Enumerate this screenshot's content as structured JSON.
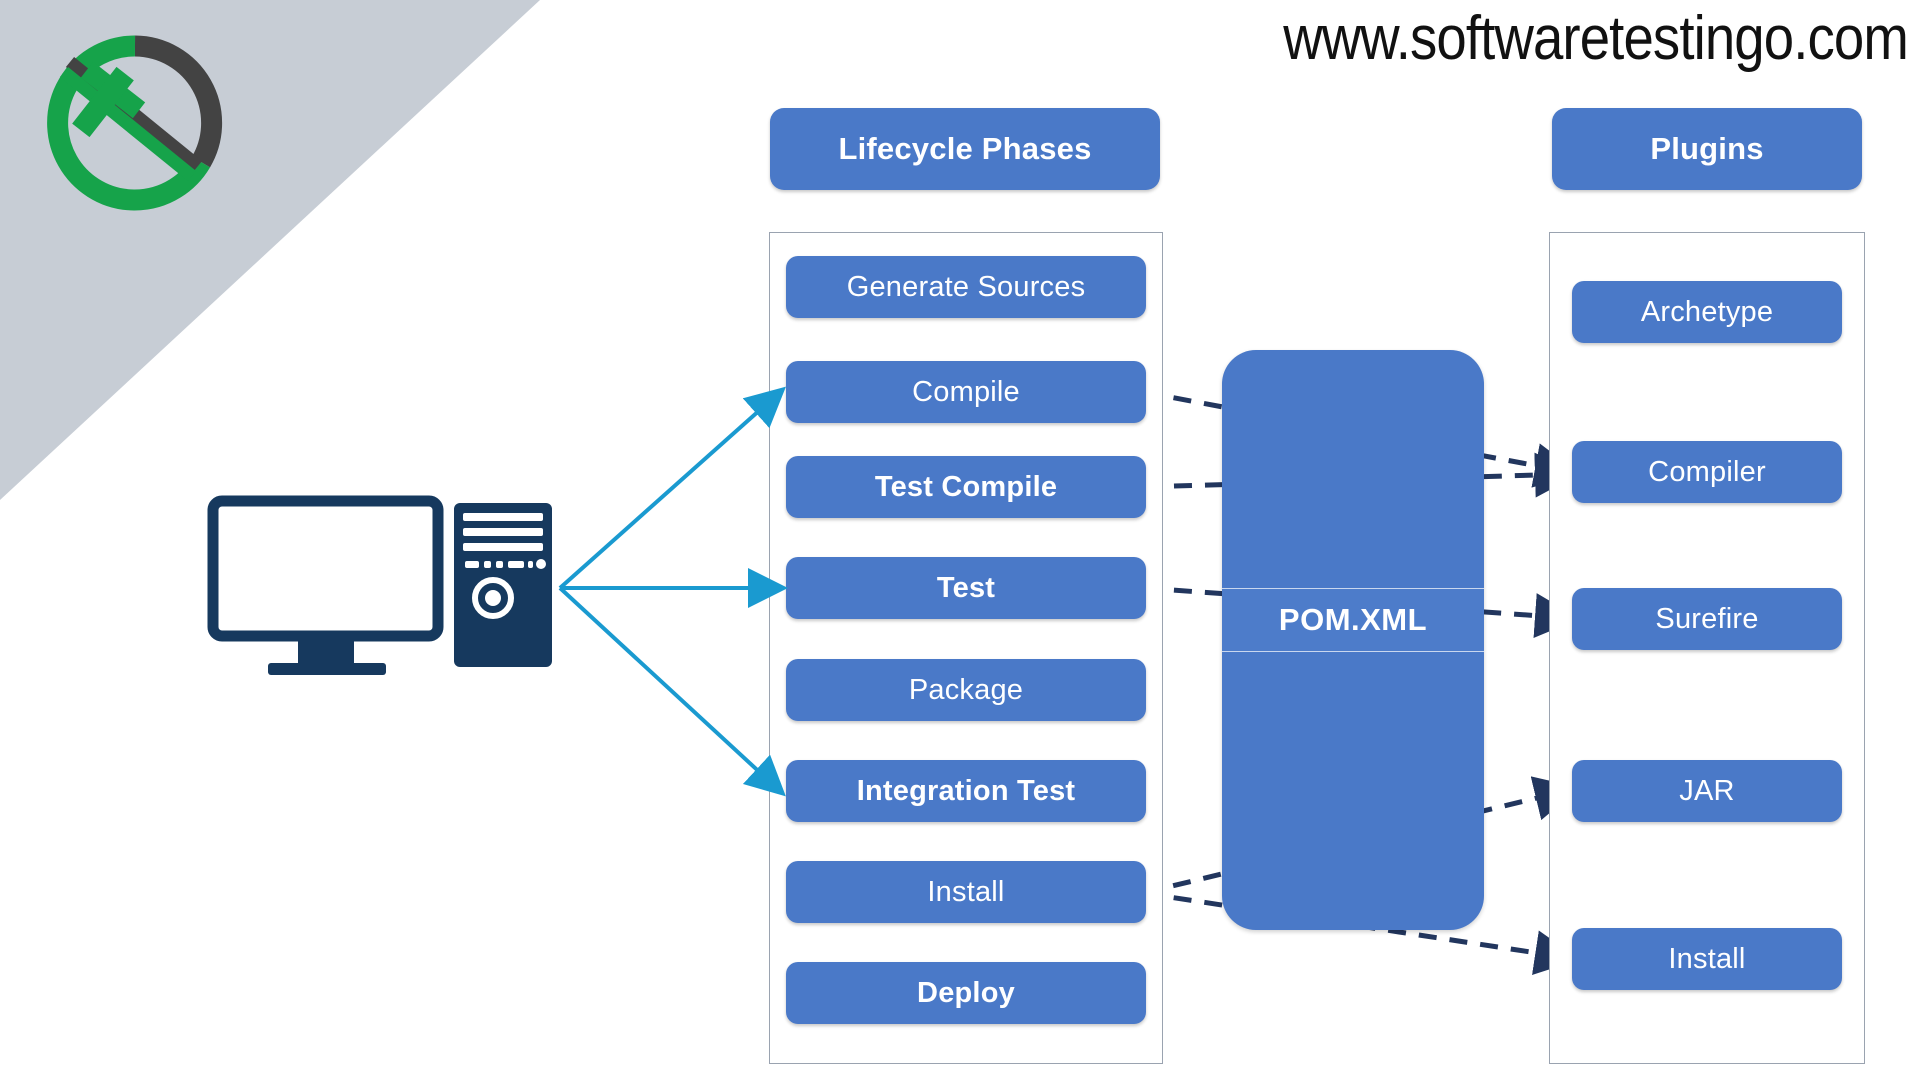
{
  "page": {
    "watermark": "www.softwaretestingo.com",
    "background_color": "#ffffff",
    "corner_color": "#c7cdd5",
    "accent_blue": "#4a79c8",
    "arrow_cyan": "#1a9ad0",
    "arrow_navy": "#22365e",
    "logo_green": "#16a34a",
    "logo_dark": "#434343"
  },
  "logo": {
    "name": "softwaretestingo-logo",
    "alt": "circular check mark logo"
  },
  "source_node": {
    "name": "developer-computer",
    "alt": "desktop computer with monitor and tower"
  },
  "lifecycle": {
    "header": "Lifecycle Phases",
    "phases": [
      {
        "label": "Generate Sources",
        "bold": false
      },
      {
        "label": "Compile",
        "bold": false
      },
      {
        "label": "Test Compile",
        "bold": true
      },
      {
        "label": "Test",
        "bold": true
      },
      {
        "label": "Package",
        "bold": false
      },
      {
        "label": "Integration Test",
        "bold": true
      },
      {
        "label": "Install",
        "bold": false
      },
      {
        "label": "Deploy",
        "bold": true
      }
    ]
  },
  "pom": {
    "label": "POM.XML"
  },
  "plugins": {
    "header": "Plugins",
    "items": [
      {
        "label": "Archetype"
      },
      {
        "label": "Compiler"
      },
      {
        "label": "Surefire"
      },
      {
        "label": "JAR"
      },
      {
        "label": "Install"
      }
    ]
  },
  "connections": {
    "from_computer": [
      "Compile",
      "Test",
      "Integration Test"
    ],
    "phase_to_plugin": [
      {
        "from": "Compile",
        "to": "Compiler"
      },
      {
        "from": "Test Compile",
        "to": "Compiler"
      },
      {
        "from": "Test",
        "to": "Surefire"
      },
      {
        "from": "Install",
        "to": "JAR"
      },
      {
        "from": "Install",
        "to": "Install"
      }
    ]
  }
}
